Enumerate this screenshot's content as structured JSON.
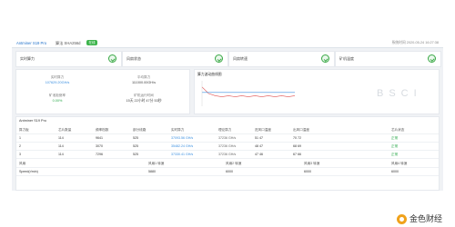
{
  "header": {
    "title": "Antminer S19 Pro",
    "algorithm": "算法 SHA256d",
    "badge": "在线",
    "timestamp": "系统时间 2020-05-24 16:27:38"
  },
  "cards": [
    {
      "label": "实时算力"
    },
    {
      "label": "风扇状态"
    },
    {
      "label": "风扇转速"
    },
    {
      "label": "矿机温度"
    }
  ],
  "summary": {
    "realtime_label": "实时算力",
    "realtime_value": "107629.20GH/s",
    "avg_label": "平均算力",
    "avg_value": "111000.00GH/s",
    "rate_label": "矿池拒绝率",
    "rate_value": "0.00%",
    "uptime_label": "矿机运行时间",
    "uptime_value": "15天 22小时 47分 53秒"
  },
  "chart": {
    "title": "算力波动曲线图",
    "watermark": "BSCI"
  },
  "chart_data": {
    "type": "line",
    "title": "算力波动曲线图",
    "series": [
      {
        "values": [
          116,
          110,
          108,
          107,
          108,
          107,
          108,
          107,
          108,
          107,
          108,
          107,
          108,
          107,
          108
        ]
      },
      {
        "values": [
          111,
          111,
          111,
          111,
          111,
          111,
          111,
          111,
          111,
          111,
          111,
          111,
          111,
          111,
          111
        ]
      }
    ],
    "ylim": [
      100,
      120
    ]
  },
  "table": {
    "title": "Antminer S19 Pro",
    "headers": [
      "算力板",
      "芯片数量",
      "频率档数",
      "部分线路",
      "实时算力",
      "理论算力",
      "进风口温度",
      "出风口温度",
      "芯片状态"
    ],
    "rows": [
      [
        "1",
        "114",
        "9641",
        "525",
        "37093.56 GH/s",
        "37236 GH/s",
        "51 47",
        "70 72",
        "正常"
      ],
      [
        "2",
        "114",
        "3070",
        "525",
        "35482.24 GH/s",
        "37236 GH/s",
        "48 47",
        "68 69",
        "正常"
      ],
      [
        "3",
        "114",
        "7296",
        "525",
        "37330.41 GH/s",
        "37236 GH/s",
        "47 46",
        "67 66",
        "正常"
      ]
    ],
    "fan_headers": [
      "风扇",
      "风扇1 转速",
      "风扇2 转速",
      "风扇3 转速",
      "风扇4 转速"
    ],
    "fan_row": [
      "Speed(r/min)",
      "5880",
      "6000",
      "6000",
      "6000"
    ]
  },
  "footer": {
    "brand": "金色财经"
  },
  "colors": {
    "accent": "#3a8fe0",
    "ok": "#2aa84a",
    "badge": "#3cb44b"
  }
}
